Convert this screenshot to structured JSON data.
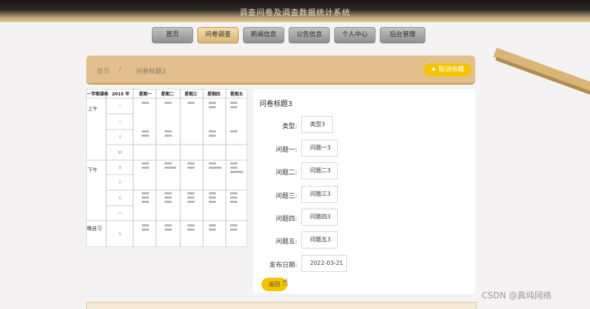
{
  "site": {
    "title": "调查问卷及调查数据统计系统"
  },
  "nav": [
    {
      "label": "首页",
      "active": false
    },
    {
      "label": "问卷调查",
      "active": true
    },
    {
      "label": "新闻信息",
      "active": false
    },
    {
      "label": "公告信息",
      "active": false
    },
    {
      "label": "个人中心",
      "active": false
    },
    {
      "label": "后台管理",
      "active": false
    }
  ],
  "breadcrumb": {
    "home": "首页",
    "sep": "/",
    "current": "问卷标题3"
  },
  "fav_button": {
    "icon": "star-icon",
    "label": "取消收藏"
  },
  "schedule": {
    "header": [
      "一学期课表",
      "2015 年",
      "星期一",
      "星期二",
      "星期三",
      "星期四",
      "星期五"
    ],
    "periods": [
      "上午",
      "下午",
      "晚自习"
    ],
    "rows": [
      "一",
      "二",
      "三",
      "四",
      "五",
      "六",
      "七",
      "八",
      "九"
    ]
  },
  "detail": {
    "title": "问卷标题3",
    "fields": [
      {
        "label": "类型:",
        "value": "类型3"
      },
      {
        "label": "问题一:",
        "value": "问题一3"
      },
      {
        "label": "问题二:",
        "value": "问题二3"
      },
      {
        "label": "问题三:",
        "value": "问题三3"
      },
      {
        "label": "问题四:",
        "value": "问题四3"
      },
      {
        "label": "问题五:",
        "value": "问题五3"
      },
      {
        "label": "发布日期:",
        "value": "2022-03-21"
      }
    ],
    "back_label": "返回"
  },
  "watermark": "CSDN @真纯网络",
  "colors": {
    "accent": "#f5c400",
    "gold": "#e2c08d"
  }
}
